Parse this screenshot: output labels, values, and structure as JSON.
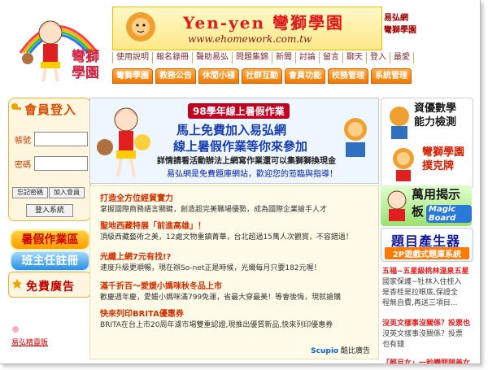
{
  "banner": {
    "title": "Yen-yen 彎獅學園",
    "url": "www.ehomework.com.tw",
    "side_line1": "易弘網",
    "side_line2": "彎獅學園"
  },
  "logo": {
    "text": "彎獅學園"
  },
  "top_links": [
    "使用說明",
    "報名錄冊",
    "聲助易弘",
    "問題集錦",
    "新聞",
    "討論",
    "留言",
    "聊天",
    "登入",
    "最愛"
  ],
  "tabs": [
    "彎獅學園",
    "教務公告",
    "休閒小棧",
    "社群互動",
    "會員功能",
    "校務管理",
    "系統管理"
  ],
  "login": {
    "title": "會員登入",
    "account_label": "帳號",
    "password_label": "密碼",
    "forgot_label": "忘記密碼",
    "join_label": "加入會員",
    "login_label": "登入系統"
  },
  "side_buttons": {
    "summer": "暑假作業區",
    "class": "班主任註冊"
  },
  "ads": {
    "title": "免費廣告"
  },
  "footer_link": "易弘精靈販",
  "center_banner": {
    "top": "98學年線上暑假作業",
    "line1": "馬上免費加入易弘網",
    "line2": "線上暑假作業等你來參加",
    "line3": "詳情請看活動辦法上網寫作業還可以集獅獅換現金",
    "line4": "易弘網是免費題庫網站，歡迎您的蒞臨與指導！"
  },
  "news": [
    {
      "title": "打造全方位經貿實力",
      "desc": "掌握國際商務語言關鍵，創造超完美職場優勢，成為國際企業搶手人才"
    },
    {
      "title": "聖地西藏特展「前進高雄」！",
      "desc": "頂級西藏藝術之美，12處文物重鎮菁華，台北超過15萬人次觀賞，不容錯過！"
    },
    {
      "title": "光纖上網7元有找!?",
      "desc": "速度升級更順暢，現在辦So-net正是時候，光纖每月只要182元喔！"
    },
    {
      "title": "滿千折百～愛媛小媽咪秋冬品上市",
      "desc": "歡慶週年慶，愛媛小媽咪滿799免運，省最大穿最美！等會後悔，現就搶購"
    },
    {
      "title": "快來列印BRITA優惠券",
      "desc": "BRITA在台上市20周年濾市場雙重認證,現推出優質新品,快來列印優惠券"
    }
  ],
  "scupio": {
    "brand": "Scupio",
    "label": "酷比廣告"
  },
  "right": {
    "box1_line1": "資優數學",
    "box1_line2": "能力檢測",
    "box1_line3": "彎獅學園",
    "box1_line4": "撲克牌",
    "board_title": "萬用揭示板",
    "board_sub": "Magic Board",
    "gen_title": "題目產生器",
    "gen_sub": "2P遊戲式題庫系統",
    "news": [
      {
        "title": "五福~五星級桃林溫泉五星",
        "desc": "國家保護~牡林入住桂入"
      },
      {
        "title": "",
        "desc": "是香桂是拉眼底,保證全"
      },
      {
        "title": "",
        "desc": "程無自費,再送三項目..."
      },
      {
        "title": "沒英文樣事沒關係？投票也",
        "desc": "沒英文樣事沒關係？投票"
      },
      {
        "title": "",
        "desc": "也有錢"
      },
      {
        "title": "「輕月女」一秒變開腿美女",
        "desc": ""
      }
    ]
  }
}
